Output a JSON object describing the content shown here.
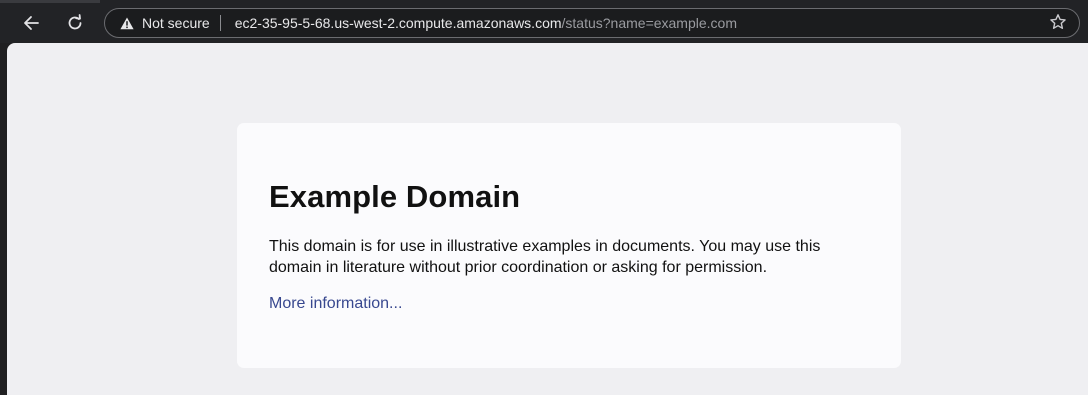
{
  "browser": {
    "security": {
      "icon": "warning-triangle-icon",
      "label": "Not secure"
    },
    "url": {
      "host": "ec2-35-95-5-68.us-west-2.compute.amazonaws.com",
      "path": "/status?name=example.com"
    },
    "icons": {
      "back": "back-arrow-icon",
      "reload": "reload-icon",
      "bookmark": "star-icon"
    }
  },
  "page": {
    "heading": "Example Domain",
    "paragraph": "This domain is for use in illustrative examples in documents. You may use this domain in literature without prior coordination or asking for permission.",
    "link_text": "More information..."
  },
  "colors": {
    "link": "#38488f",
    "page_background": "#efeff2",
    "card_background": "#fbfbfd",
    "toolbar_background": "#222326"
  }
}
